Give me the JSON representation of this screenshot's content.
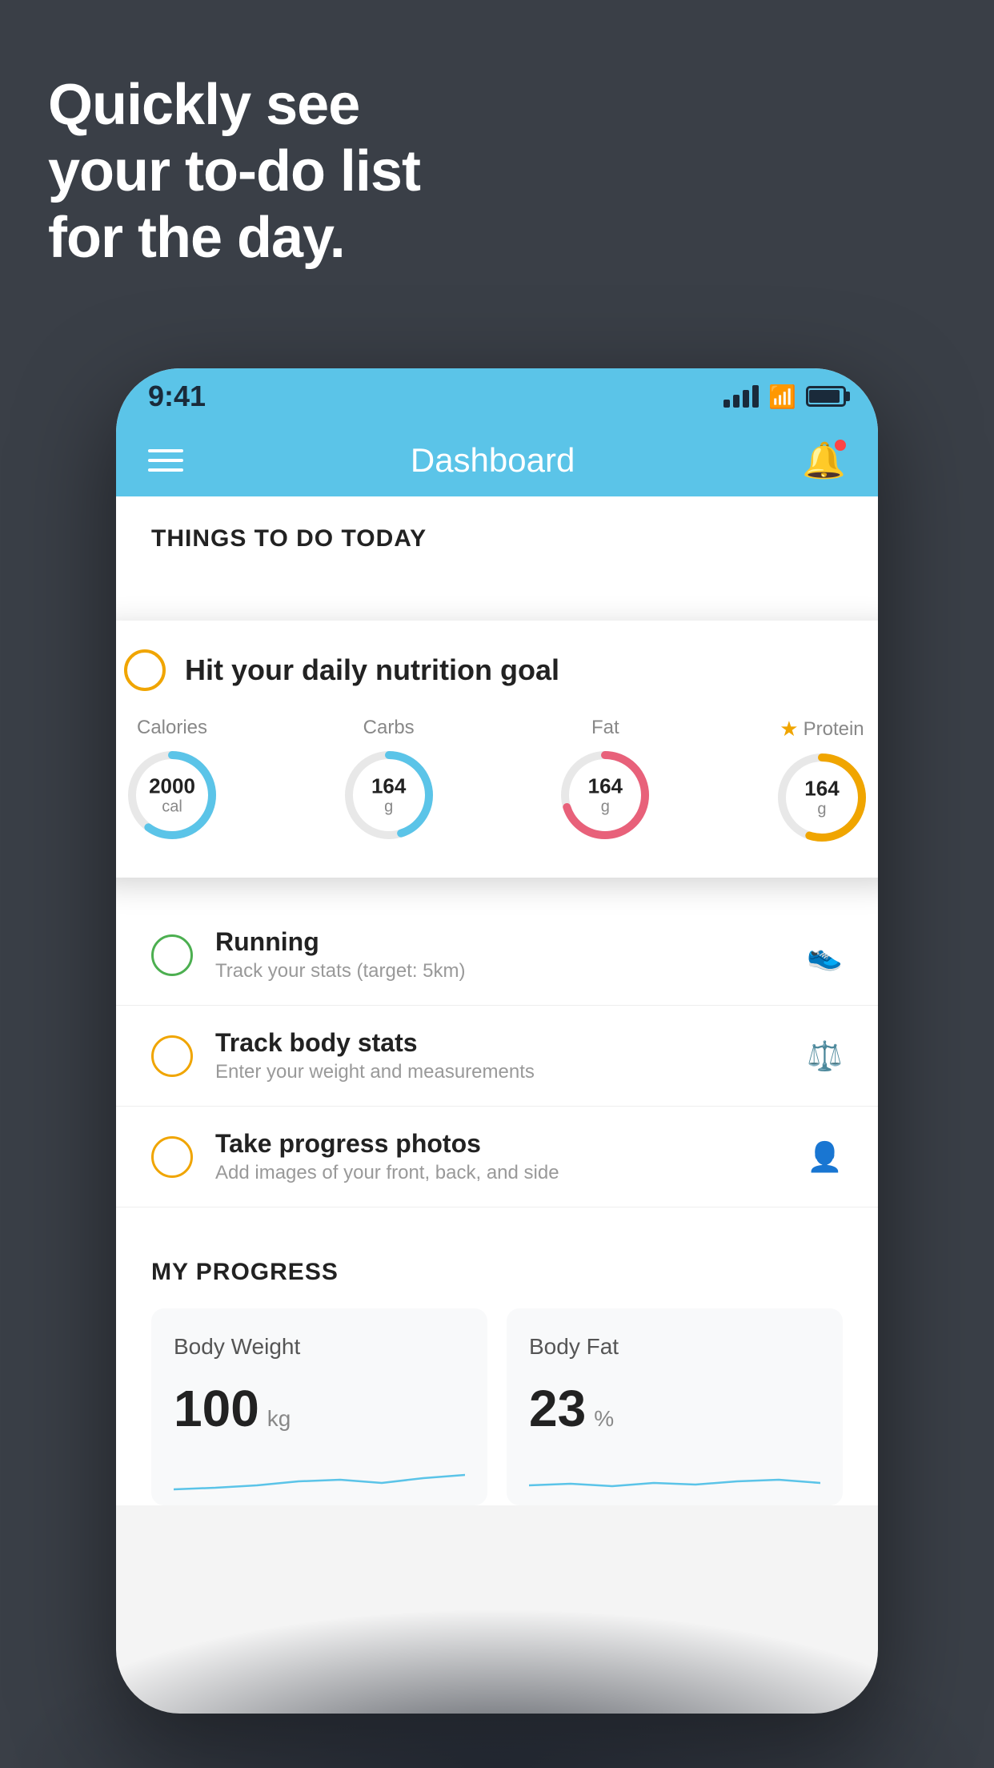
{
  "headline": {
    "line1": "Quickly see",
    "line2": "your to-do list",
    "line3": "for the day."
  },
  "status_bar": {
    "time": "9:41"
  },
  "nav": {
    "title": "Dashboard"
  },
  "things_section": {
    "header": "THINGS TO DO TODAY"
  },
  "floating_card": {
    "title": "Hit your daily nutrition goal",
    "nutrients": [
      {
        "label": "Calories",
        "value": "2000",
        "unit": "cal",
        "color": "#5bc4e8",
        "track": 0.6
      },
      {
        "label": "Carbs",
        "value": "164",
        "unit": "g",
        "color": "#5bc4e8",
        "track": 0.45
      },
      {
        "label": "Fat",
        "value": "164",
        "unit": "g",
        "color": "#e8617a",
        "track": 0.7
      },
      {
        "label": "Protein",
        "value": "164",
        "unit": "g",
        "color": "#f0a500",
        "track": 0.55,
        "starred": true
      }
    ]
  },
  "todo_items": [
    {
      "title": "Running",
      "sub": "Track your stats (target: 5km)",
      "circle_color": "green",
      "icon": "👟"
    },
    {
      "title": "Track body stats",
      "sub": "Enter your weight and measurements",
      "circle_color": "yellow",
      "icon": "⚖️"
    },
    {
      "title": "Take progress photos",
      "sub": "Add images of your front, back, and side",
      "circle_color": "yellow",
      "icon": "👤"
    }
  ],
  "progress": {
    "header": "MY PROGRESS",
    "cards": [
      {
        "title": "Body Weight",
        "value": "100",
        "unit": "kg"
      },
      {
        "title": "Body Fat",
        "value": "23",
        "unit": "%"
      }
    ]
  }
}
